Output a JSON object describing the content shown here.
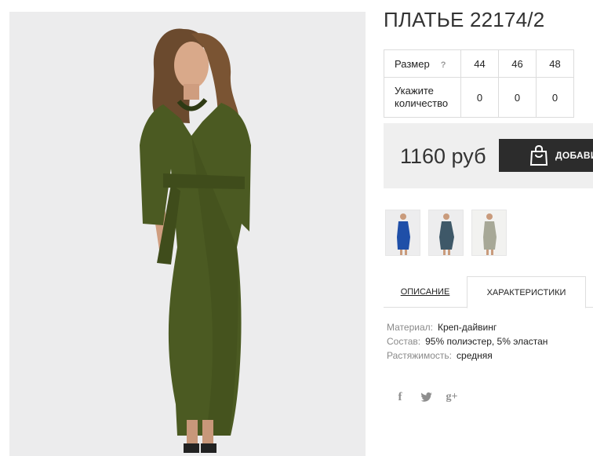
{
  "product": {
    "title": "ПЛАТЬЕ 22174/2",
    "photo_icon": "dress-photo",
    "thumbnails": [
      {
        "color_name": "blue",
        "color": "#1f4fa8"
      },
      {
        "color_name": "slate",
        "color": "#3e5868"
      },
      {
        "color_name": "beige",
        "color": "#a7a897"
      }
    ]
  },
  "size_table": {
    "size_label": "Размер",
    "help_mark": "?",
    "sizes": [
      "44",
      "46",
      "48"
    ],
    "quantity_label": "Укажите количество",
    "quantities": [
      "0",
      "0",
      "0"
    ]
  },
  "purchase": {
    "price": "1160 руб",
    "add_label": "ДОБАВИТЬ В КОРЗИНУ",
    "add_icon": "shopping-bag-icon"
  },
  "tabs": {
    "description": "ОПИСАНИЕ",
    "characteristics": "ХАРАКТЕРИСТИКИ",
    "active": "characteristics"
  },
  "specs": [
    {
      "key": "Материал:",
      "value": "Креп-дайвинг"
    },
    {
      "key": "Состав:",
      "value": "95% полиэстер, 5% эластан"
    },
    {
      "key": "Растяжимость:",
      "value": "средняя"
    }
  ],
  "share": {
    "facebook": "f",
    "twitter": "twitter-bird-icon",
    "googleplus": "g+"
  },
  "colors": {
    "dress": "#4b5a22",
    "button": "#2c2c2c",
    "price_bar": "#efefef"
  }
}
